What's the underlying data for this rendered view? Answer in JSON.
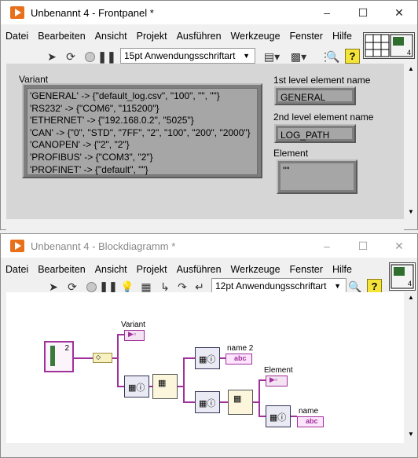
{
  "frontpanel": {
    "title": "Unbenannt 4 - Frontpanel *",
    "menu": [
      "Datei",
      "Bearbeiten",
      "Ansicht",
      "Projekt",
      "Ausführen",
      "Werkzeuge",
      "Fenster",
      "Hilfe"
    ],
    "font_select": "15pt Anwendungsschriftart",
    "variant_label": "Variant",
    "variant_lines": [
      "'GENERAL' -> {\"default_log.csv\", \"100\", \"\", \"\"}",
      "'RS232' -> {\"COM6\", \"115200\"}",
      "'ETHERNET' -> {\"192.168.0.2\", \"5025\"}",
      "'CAN' -> {\"0\", \"STD\", \"7FF\", \"2\", \"100\", \"200\", \"2000\"}",
      "'CANOPEN' -> {\"2\", \"2\"}",
      "'PROFIBUS' -> {\"COM3\", \"2\"}",
      "'PROFINET' -> {\"default\", \"\"}"
    ],
    "first_level_label": "1st level element name",
    "first_level_value": "GENERAL",
    "second_level_label": "2nd level element name",
    "second_level_value": "LOG_PATH",
    "element_label": "Element",
    "element_value": "\"\""
  },
  "blockdiagram": {
    "title": "Unbenannt 4 - Blockdiagramm *",
    "menu": [
      "Datei",
      "Bearbeiten",
      "Ansicht",
      "Projekt",
      "Ausführen",
      "Werkzeuge",
      "Fenster",
      "Hilfe"
    ],
    "font_select": "12pt Anwendungsschriftart",
    "variant_label": "Variant",
    "name2_label": "name 2",
    "element_label": "Element",
    "name_label": "name",
    "loop_count": "2",
    "indicator_text": "abc"
  },
  "icons": [
    "run-arrow-icon",
    "run-continuous-icon",
    "abort-icon",
    "pause-icon",
    "highlight-bulb-icon",
    "align-icon",
    "distribute-icon",
    "resize-icon",
    "reorder-icon",
    "search-icon",
    "help-icon",
    "minimize-icon",
    "maximize-icon",
    "close-icon"
  ],
  "colors": {
    "wire_variant": "#a0309a",
    "panel": "#d6d6d6",
    "help": "#f4e43a",
    "lv_orange": "#e8701a"
  }
}
